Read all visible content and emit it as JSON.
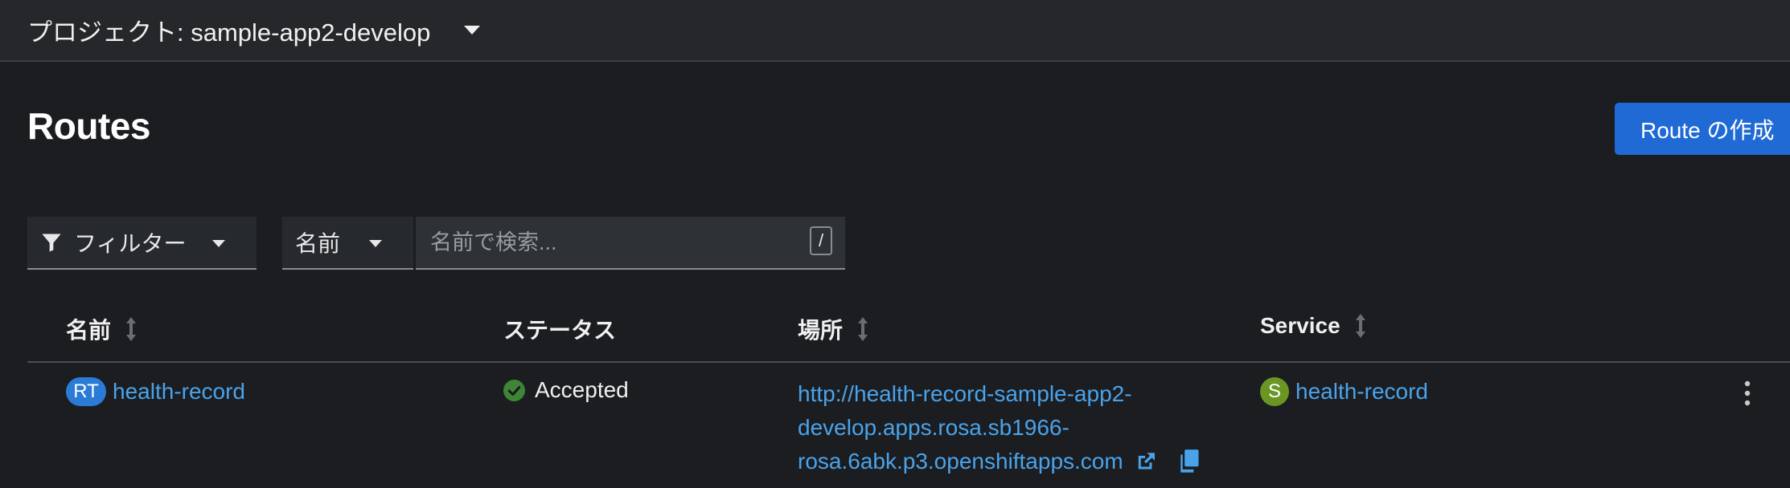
{
  "project": {
    "label": "プロジェクト: sample-app2-develop"
  },
  "page": {
    "title": "Routes",
    "create_button": "Route の作成"
  },
  "toolbar": {
    "filter_label": "フィルター",
    "name_dropdown_label": "名前",
    "search_placeholder": "名前で検索...",
    "search_shortcut": "/"
  },
  "table": {
    "headers": {
      "name": "名前",
      "status": "ステータス",
      "location": "場所",
      "service": "Service"
    },
    "rows": [
      {
        "name_badge": "RT",
        "name": "health-record",
        "status": "Accepted",
        "location_lines": [
          "http://health-record-sample-app2-",
          "develop.apps.rosa.sb1966-",
          "rosa.6abk.p3.openshiftapps.com"
        ],
        "service_badge": "S",
        "service": "health-record"
      }
    ]
  },
  "colors": {
    "background": "#1b1d21",
    "accent_blue": "#1f6ad4",
    "link": "#4aa3ea",
    "status_ok": "#3e8635",
    "service_badge": "#6b9624",
    "route_badge": "#2b7bd6"
  },
  "icons": {
    "project_caret": "chevron-down-icon",
    "filter": "filter-icon",
    "status": "check-circle-icon",
    "external_link": "external-link-icon",
    "copy": "copy-icon",
    "kebab": "kebab-icon",
    "sort": "sort-icon"
  }
}
